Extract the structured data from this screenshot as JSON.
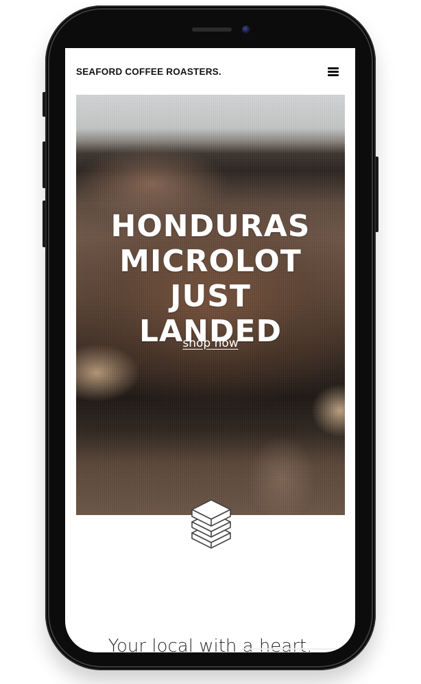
{
  "header": {
    "logo_text": "SEAFORD COFFEE ROASTERS.",
    "menu_icon": "hamburger-menu-icon"
  },
  "hero": {
    "title_lines": [
      "HONDURAS",
      "MICROLOT",
      "JUST",
      "LANDED"
    ],
    "cta_label": "shop now",
    "text_color": "#ffffff"
  },
  "section": {
    "icon": "stacked-layers-icon",
    "tagline": "Your local with a heart."
  },
  "device": {
    "frame": "smartphone",
    "frame_color": "#0c0c0c"
  }
}
